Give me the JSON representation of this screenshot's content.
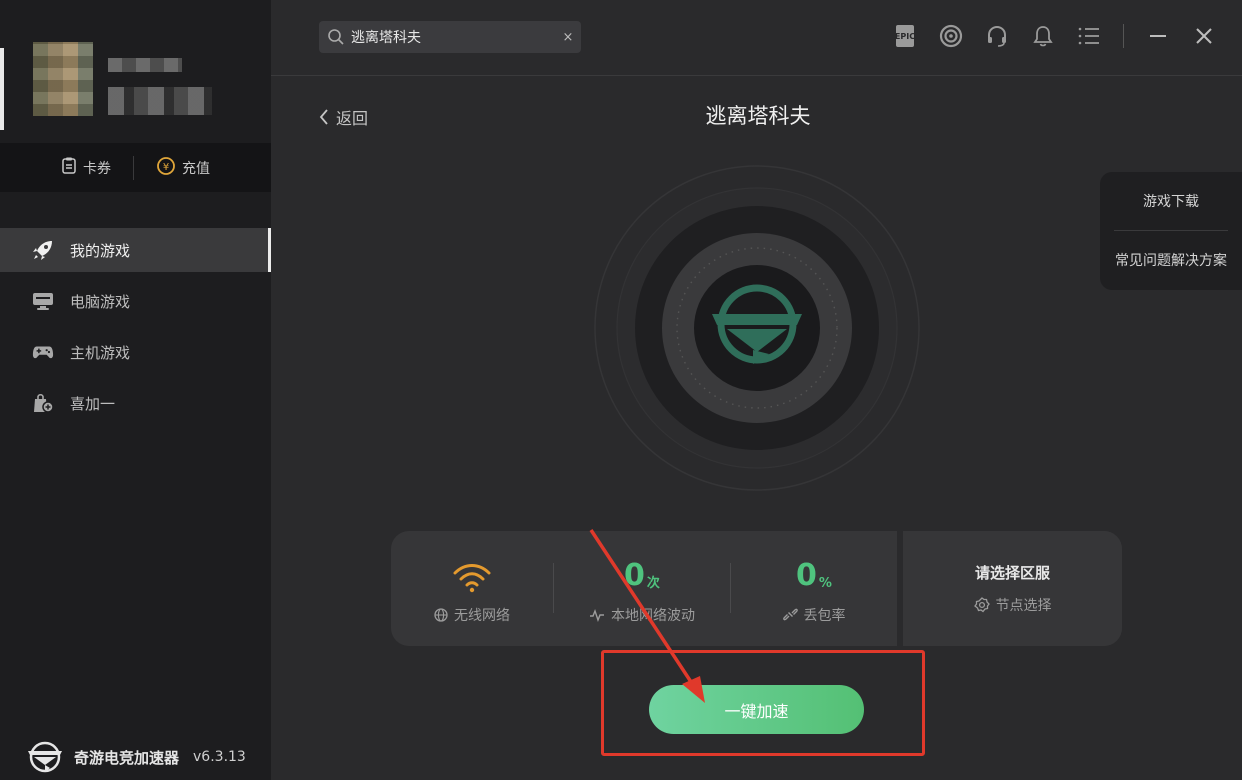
{
  "sidebar": {
    "wallet": {
      "coupon_label": "卡券",
      "recharge_label": "充值",
      "recharge_icon_text": "¥"
    },
    "nav_items": [
      {
        "label": "我的游戏",
        "icon": "rocket-icon",
        "active": true
      },
      {
        "label": "电脑游戏",
        "icon": "monitor-icon",
        "active": false
      },
      {
        "label": "主机游戏",
        "icon": "gamepad-icon",
        "active": false
      },
      {
        "label": "喜加一",
        "icon": "gift-bag-icon",
        "active": false
      }
    ],
    "brand": {
      "name": "奇游电竞加速器",
      "version": "v6.3.13"
    }
  },
  "header": {
    "search_value": "逃离塔科夫",
    "clear_glyph": "×",
    "icons": [
      "epic-games-icon",
      "ubisoft-icon",
      "headset-icon",
      "bell-icon",
      "menu-icon",
      "minimize-icon",
      "close-icon"
    ],
    "epic_text": "EPIC"
  },
  "main": {
    "back_label": "返回",
    "title": "逃离塔科夫",
    "side_panel": {
      "items": [
        "游戏下载",
        "常见问题解决方案"
      ]
    },
    "stats": {
      "network_label": "无线网络",
      "fluctuation_value": "0",
      "fluctuation_unit": "次",
      "fluctuation_label": "本地网络波动",
      "loss_value": "0",
      "loss_unit": "%",
      "loss_label": "丢包率",
      "region_title": "请选择区服",
      "node_label": "节点选择"
    },
    "accelerate_label": "一键加速"
  },
  "colors": {
    "accent_green": "#54c074",
    "wifi_orange": "#e49a2e",
    "annotation_red": "#e0392b"
  }
}
